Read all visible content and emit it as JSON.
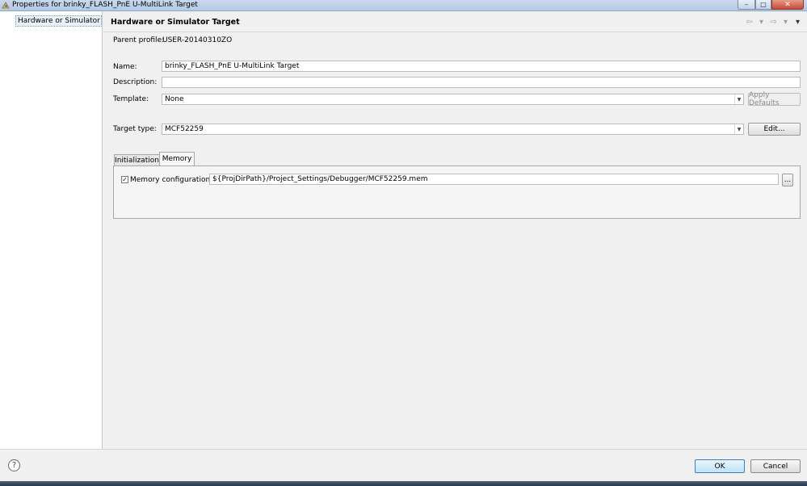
{
  "window": {
    "title": "Properties for brinky_FLASH_PnE U-MultiLink Target"
  },
  "nav": {
    "items": [
      {
        "label": "Hardware or Simulator Target"
      }
    ]
  },
  "panel": {
    "title": "Hardware or Simulator Target",
    "parent_profile_label": "Parent profile:",
    "parent_profile_value": "USER-20140310ZO",
    "name_label": "Name:",
    "name_value": "brinky_FLASH_PnE U-MultiLink Target",
    "description_label": "Description:",
    "description_value": "",
    "template_label": "Template:",
    "template_value": "None",
    "apply_defaults_label": "Apply Defaults",
    "target_type_label": "Target type:",
    "target_type_value": "MCF52259",
    "edit_label": "Edit...",
    "tabs": [
      {
        "label": "Initialization"
      },
      {
        "label": "Memory"
      }
    ],
    "active_tab": "Memory",
    "memory_config_label": "Memory configuration:",
    "memory_config_checked": true,
    "memory_config_path": "${ProjDirPath}/Project_Settings/Debugger/MCF52259.mem",
    "browse_label": "..."
  },
  "footer": {
    "ok_label": "OK",
    "cancel_label": "Cancel"
  },
  "icons": [
    "app-icon",
    "minimize-icon",
    "maximize-icon",
    "close-icon",
    "back-arrow-icon",
    "forward-arrow-icon",
    "menu-dropdown-icon",
    "help-icon",
    "dropdown-arrow-icon",
    "checkmark-icon"
  ]
}
